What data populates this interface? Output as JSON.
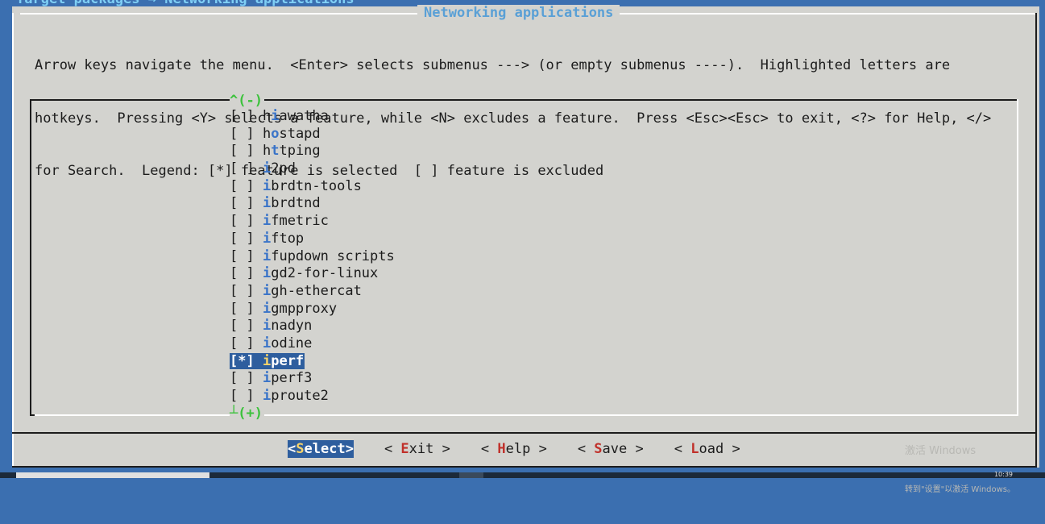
{
  "breadcrumb": "Target packages → Networking applications",
  "dialog": {
    "title": "Networking applications",
    "help_lines": [
      "Arrow keys navigate the menu.  <Enter> selects submenus ---> (or empty submenus ----).  Highlighted letters are",
      "hotkeys.  Pressing <Y> selects a feature, while <N> excludes a feature.  Press <Esc><Esc> to exit, <?> for Help, </>",
      "for Search.  Legend: [*] feature is selected  [ ] feature is excluded"
    ]
  },
  "menu": {
    "scroll_up": "^(-)",
    "scroll_down": "┴(+)",
    "items": [
      {
        "box": "[ ]",
        "pre": "h",
        "hot": "i",
        "rest": "awatha",
        "selected": false
      },
      {
        "box": "[ ]",
        "pre": "h",
        "hot": "o",
        "rest": "stapd",
        "selected": false
      },
      {
        "box": "[ ]",
        "pre": "h",
        "hot": "t",
        "rest": "tping",
        "selected": false
      },
      {
        "box": "[ ]",
        "pre": "",
        "hot": "i",
        "rest": "2pd",
        "selected": false
      },
      {
        "box": "[ ]",
        "pre": "",
        "hot": "i",
        "rest": "brdtn-tools",
        "selected": false
      },
      {
        "box": "[ ]",
        "pre": "",
        "hot": "i",
        "rest": "brdtnd",
        "selected": false
      },
      {
        "box": "[ ]",
        "pre": "",
        "hot": "i",
        "rest": "fmetric",
        "selected": false
      },
      {
        "box": "[ ]",
        "pre": "",
        "hot": "i",
        "rest": "ftop",
        "selected": false
      },
      {
        "box": "[ ]",
        "pre": "",
        "hot": "i",
        "rest": "fupdown scripts",
        "selected": false
      },
      {
        "box": "[ ]",
        "pre": "",
        "hot": "i",
        "rest": "gd2-for-linux",
        "selected": false
      },
      {
        "box": "[ ]",
        "pre": "",
        "hot": "i",
        "rest": "gh-ethercat",
        "selected": false
      },
      {
        "box": "[ ]",
        "pre": "",
        "hot": "i",
        "rest": "gmpproxy",
        "selected": false
      },
      {
        "box": "[ ]",
        "pre": "",
        "hot": "i",
        "rest": "nadyn",
        "selected": false
      },
      {
        "box": "[ ]",
        "pre": "",
        "hot": "i",
        "rest": "odine",
        "selected": false
      },
      {
        "box": "[*]",
        "pre": "",
        "hot": "i",
        "rest": "perf",
        "selected": true
      },
      {
        "box": "[ ]",
        "pre": "",
        "hot": "i",
        "rest": "perf3",
        "selected": false
      },
      {
        "box": "[ ]",
        "pre": "",
        "hot": "i",
        "rest": "proute2",
        "selected": false
      }
    ]
  },
  "buttons": [
    {
      "id": "select",
      "open": "<",
      "hot": "S",
      "rest": "elect",
      "close": ">",
      "active": true
    },
    {
      "id": "exit",
      "open": "< ",
      "hot": "E",
      "rest": "xit",
      "close": " >",
      "active": false
    },
    {
      "id": "help",
      "open": "< ",
      "hot": "H",
      "rest": "elp",
      "close": " >",
      "active": false
    },
    {
      "id": "save",
      "open": "< ",
      "hot": "S",
      "rest": "ave",
      "close": " >",
      "active": false
    },
    {
      "id": "load",
      "open": "< ",
      "hot": "L",
      "rest": "oad",
      "close": " >",
      "active": false
    }
  ],
  "watermark": {
    "line1": "激活 Windows",
    "line2": "转到\"设置\"以激活 Windows。"
  },
  "taskbar": {
    "clock": "10:39"
  }
}
